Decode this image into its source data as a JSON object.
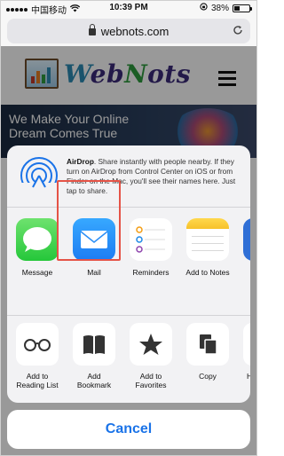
{
  "status_bar": {
    "carrier": "中国移动",
    "time": "10:39 PM",
    "battery": "38%",
    "battery_level": 0.38
  },
  "browser": {
    "url": "webnots.com"
  },
  "page": {
    "logo_text": {
      "w": "W",
      "eb": "eb",
      "n": "N",
      "ots": "ots"
    },
    "banner_text": "We Make Your Online Dream Comes True"
  },
  "share_sheet": {
    "airdrop": {
      "title": "AirDrop",
      "description": ". Share instantly with people nearby. If they turn on AirDrop from Control Center on iOS or from Finder on the Mac, you'll see their names here. Just tap to share."
    },
    "apps": [
      {
        "label": "Message",
        "icon": "messages-icon"
      },
      {
        "label": "Mail",
        "icon": "mail-icon"
      },
      {
        "label": "Reminders",
        "icon": "reminders-icon"
      },
      {
        "label": "Add to Notes",
        "icon": "notes-icon"
      }
    ],
    "actions": [
      {
        "label_line1": "Add to",
        "label_line2": "Reading List",
        "icon": "glasses-icon"
      },
      {
        "label_line1": "Add",
        "label_line2": "Bookmark",
        "icon": "book-icon",
        "highlighted": true
      },
      {
        "label_line1": "Add to",
        "label_line2": "Favorites",
        "icon": "star-icon"
      },
      {
        "label_line1": "Copy",
        "label_line2": "",
        "icon": "copy-icon"
      },
      {
        "label_line1": "Ho",
        "label_line2": "",
        "icon": "add-to-home-icon"
      }
    ],
    "cancel_label": "Cancel"
  },
  "colors": {
    "accent": "#1a73e8",
    "highlight": "#e55346"
  }
}
